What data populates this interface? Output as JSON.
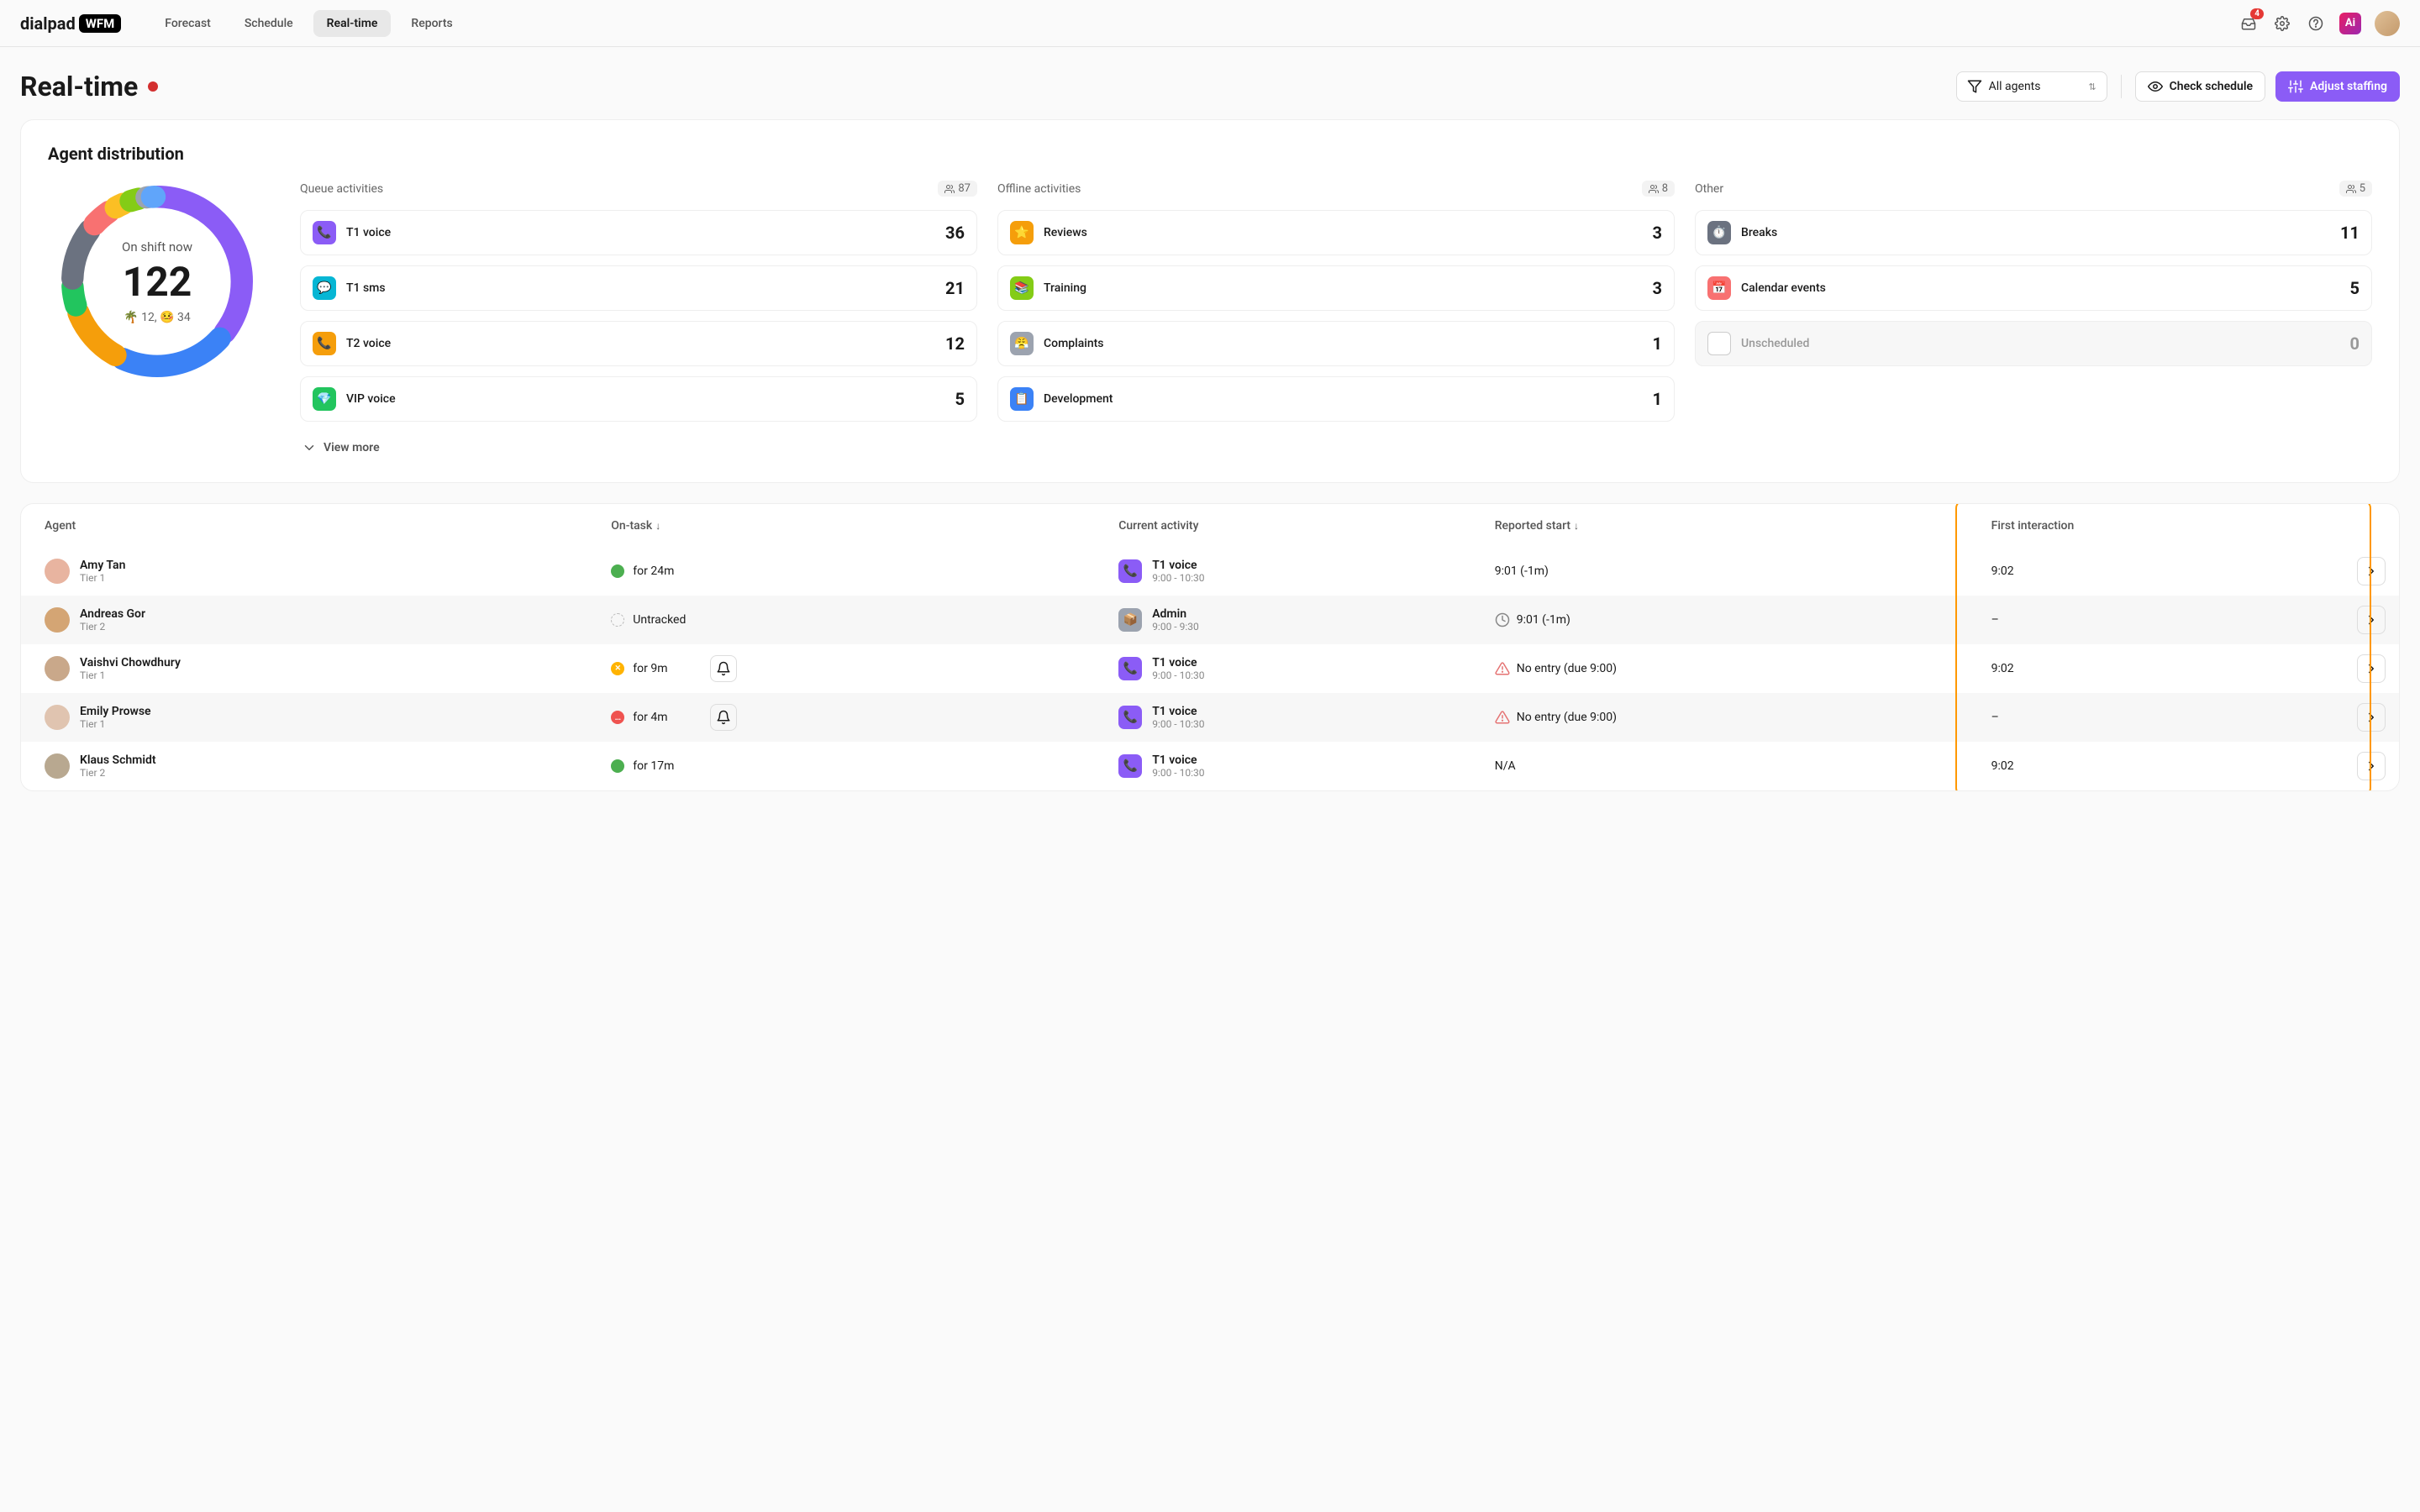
{
  "brand": {
    "name": "dialpad",
    "suffix": "WFM"
  },
  "nav": {
    "items": [
      {
        "label": "Forecast",
        "active": false
      },
      {
        "label": "Schedule",
        "active": false
      },
      {
        "label": "Real-time",
        "active": true
      },
      {
        "label": "Reports",
        "active": false
      }
    ]
  },
  "header": {
    "notification_badge": "4"
  },
  "toolbar": {
    "title": "Real-time",
    "filter_label": "All agents",
    "check_schedule": "Check schedule",
    "adjust_staffing": "Adjust staffing"
  },
  "distribution": {
    "title": "Agent distribution",
    "on_shift_label": "On shift now",
    "on_shift_value": "122",
    "sub_status": "🌴 12, 🤒 34",
    "view_more": "View more",
    "columns": [
      {
        "title": "Queue activities",
        "count": "87",
        "items": [
          {
            "name": "T1 voice",
            "value": "36",
            "emoji": "📞",
            "bg": "#8b5cf6"
          },
          {
            "name": "T1 sms",
            "value": "21",
            "emoji": "💬",
            "bg": "#06b6d4"
          },
          {
            "name": "T2 voice",
            "value": "12",
            "emoji": "📞",
            "bg": "#f59e0b"
          },
          {
            "name": "VIP voice",
            "value": "5",
            "emoji": "💎",
            "bg": "#22c55e"
          }
        ]
      },
      {
        "title": "Offline activities",
        "count": "8",
        "items": [
          {
            "name": "Reviews",
            "value": "3",
            "emoji": "⭐",
            "bg": "#f59e0b"
          },
          {
            "name": "Training",
            "value": "3",
            "emoji": "📚",
            "bg": "#84cc16"
          },
          {
            "name": "Complaints",
            "value": "1",
            "emoji": "😤",
            "bg": "#9ca3af"
          },
          {
            "name": "Development",
            "value": "1",
            "emoji": "📋",
            "bg": "#3b82f6"
          }
        ]
      },
      {
        "title": "Other",
        "count": "5",
        "items": [
          {
            "name": "Breaks",
            "value": "11",
            "emoji": "⏱️",
            "bg": "#6b7280"
          },
          {
            "name": "Calendar events",
            "value": "5",
            "emoji": "📅",
            "bg": "#f87171"
          },
          {
            "name": "Unscheduled",
            "value": "0",
            "emoji": "",
            "bg": "#fff",
            "muted": true,
            "checkbox": true
          }
        ]
      }
    ]
  },
  "chart_data": {
    "type": "donut",
    "title": "On shift now",
    "total": 122,
    "note": "🌴 12, 🤒 34",
    "series": [
      {
        "name": "T1 voice",
        "value": 36,
        "color": "#8b5cf6"
      },
      {
        "name": "T1 sms",
        "value": 21,
        "color": "#3b82f6"
      },
      {
        "name": "T2 voice",
        "value": 12,
        "color": "#f59e0b"
      },
      {
        "name": "VIP voice",
        "value": 5,
        "color": "#22c55e"
      },
      {
        "name": "Breaks",
        "value": 11,
        "color": "#6b7280"
      },
      {
        "name": "Calendar events",
        "value": 5,
        "color": "#f87171"
      },
      {
        "name": "Reviews",
        "value": 3,
        "color": "#fbbf24"
      },
      {
        "name": "Training",
        "value": 3,
        "color": "#84cc16"
      },
      {
        "name": "Complaints",
        "value": 1,
        "color": "#9ca3af"
      },
      {
        "name": "Development",
        "value": 1,
        "color": "#60a5fa"
      }
    ]
  },
  "table": {
    "columns": {
      "agent": "Agent",
      "on_task": "On-task",
      "current_activity": "Current activity",
      "reported_start": "Reported start",
      "first_interaction": "First interaction"
    },
    "rows": [
      {
        "name": "Amy Tan",
        "tier": "Tier 1",
        "ontask_status": "green",
        "ontask_text": "for 24m",
        "bell": false,
        "act_name": "T1 voice",
        "act_time": "9:00 - 10:30",
        "act_bg": "#8b5cf6",
        "act_emoji": "📞",
        "reported": "9:01 (-1m)",
        "reported_icon": "",
        "first": "9:02"
      },
      {
        "name": "Andreas Gor",
        "tier": "Tier 2",
        "ontask_status": "dashed",
        "ontask_text": "Untracked",
        "bell": false,
        "act_name": "Admin",
        "act_time": "9:00 - 9:30",
        "act_bg": "#9ca3af",
        "act_emoji": "📦",
        "reported": "9:01 (-1m)",
        "reported_icon": "clock",
        "first": "–"
      },
      {
        "name": "Vaishvi Chowdhury",
        "tier": "Tier 1",
        "ontask_status": "amber",
        "ontask_text": "for 9m",
        "bell": true,
        "act_name": "T1 voice",
        "act_time": "9:00 - 10:30",
        "act_bg": "#8b5cf6",
        "act_emoji": "📞",
        "reported": "No entry (due 9:00)",
        "reported_icon": "warn",
        "first": "9:02"
      },
      {
        "name": "Emily Prowse",
        "tier": "Tier 1",
        "ontask_status": "red",
        "ontask_text": "for 4m",
        "bell": true,
        "act_name": "T1 voice",
        "act_time": "9:00 - 10:30",
        "act_bg": "#8b5cf6",
        "act_emoji": "📞",
        "reported": "No entry (due 9:00)",
        "reported_icon": "warn",
        "first": "–"
      },
      {
        "name": "Klaus Schmidt",
        "tier": "Tier 2",
        "ontask_status": "green",
        "ontask_text": "for 17m",
        "bell": false,
        "act_name": "T1 voice",
        "act_time": "9:00 - 10:30",
        "act_bg": "#8b5cf6",
        "act_emoji": "📞",
        "reported": "N/A",
        "reported_icon": "",
        "first": "9:02"
      }
    ]
  }
}
